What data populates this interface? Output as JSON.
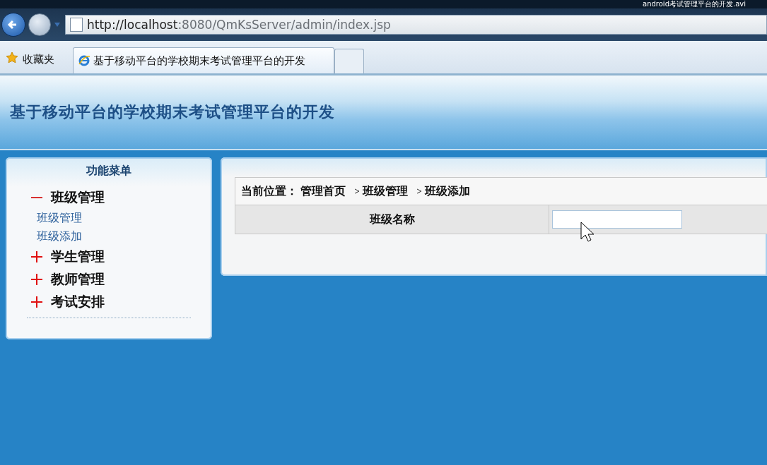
{
  "window": {
    "title": "android考试管理平台的开发.avi"
  },
  "address_bar": {
    "url_host": "http://localhost",
    "url_rest": ":8080/QmKsServer/admin/index.jsp"
  },
  "favorites": {
    "label": "收藏夹"
  },
  "tabs": [
    {
      "label": "基于移动平台的学校期末考试管理平台的开发",
      "selected": true
    }
  ],
  "header": {
    "title": "基于移动平台的学校期末考试管理平台的开发"
  },
  "sidebar": {
    "title": "功能菜单",
    "groups": [
      {
        "label": "班级管理",
        "expanded": true,
        "children": [
          {
            "label": "班级管理"
          },
          {
            "label": "班级添加"
          }
        ]
      },
      {
        "label": "学生管理",
        "expanded": false
      },
      {
        "label": "教师管理",
        "expanded": false
      },
      {
        "label": "考试安排",
        "expanded": false
      }
    ]
  },
  "breadcrumb": {
    "prefix": "当前位置：",
    "items": [
      "管理首页",
      "班级管理",
      "班级添加"
    ]
  },
  "form": {
    "rows": [
      {
        "label": "班级名称"
      }
    ]
  }
}
